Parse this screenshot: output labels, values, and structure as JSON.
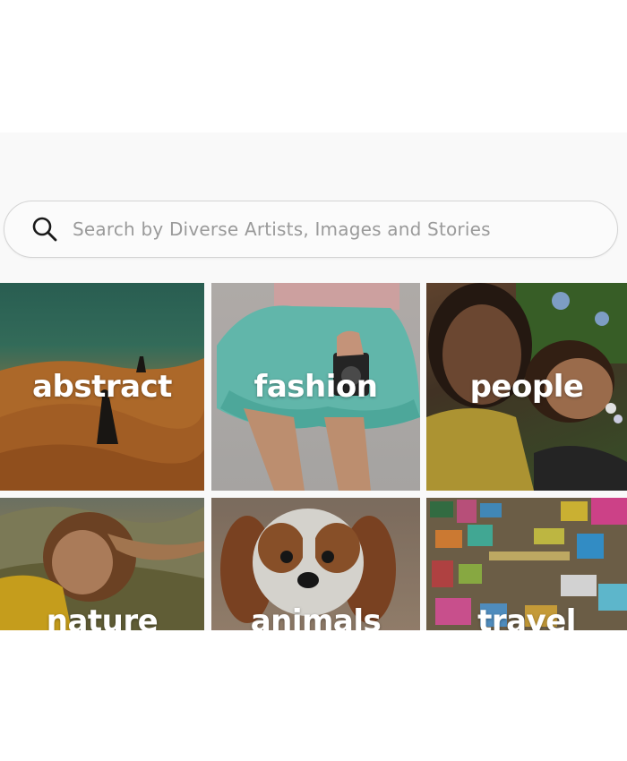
{
  "search": {
    "placeholder": "Search by Diverse Artists, Images and Stories"
  },
  "categories": [
    {
      "label": "abstract"
    },
    {
      "label": "fashion"
    },
    {
      "label": "people"
    },
    {
      "label": "nature"
    },
    {
      "label": "animals"
    },
    {
      "label": "travel"
    }
  ]
}
